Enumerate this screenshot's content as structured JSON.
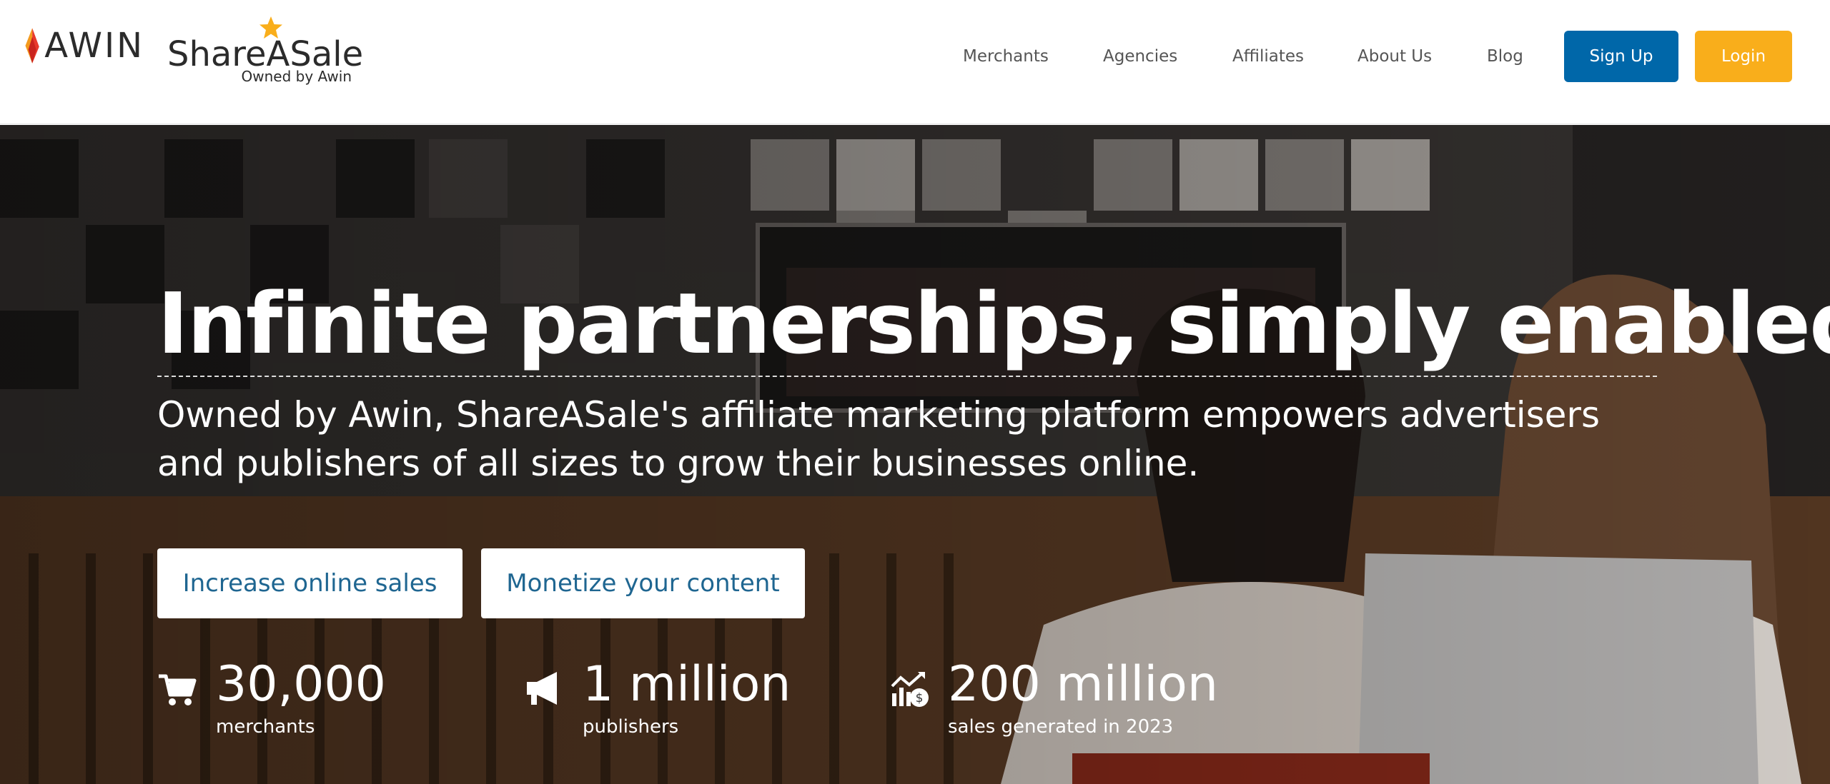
{
  "header": {
    "awin_logo_text": "AWIN",
    "shareasale_logo_text": "ShareASale",
    "shareasale_tagline": "Owned by Awin",
    "nav": [
      {
        "label": "Merchants"
      },
      {
        "label": "Agencies"
      },
      {
        "label": "Affiliates"
      },
      {
        "label": "About Us"
      },
      {
        "label": "Blog"
      }
    ],
    "signup_label": "Sign Up",
    "login_label": "Login"
  },
  "hero": {
    "title": "Infinite partnerships, simply enabled.",
    "subtitle": "Owned by Awin, ShareASale's affiliate marketing platform empowers advertisers and publishers of all sizes to grow their businesses online.",
    "cta_primary": "Increase online sales",
    "cta_secondary": "Monetize your content",
    "stats": [
      {
        "icon": "cart-icon",
        "value": "30,000",
        "label": "merchants"
      },
      {
        "icon": "megaphone-icon",
        "value": "1 million",
        "label": "publishers"
      },
      {
        "icon": "sales-growth-icon",
        "value": "200 million",
        "label": "sales generated in 2023"
      }
    ]
  },
  "colors": {
    "brand_blue": "#0067a9",
    "brand_orange": "#f9ae1b",
    "cta_text": "#1f6691",
    "awin_red": "#e8392c"
  }
}
